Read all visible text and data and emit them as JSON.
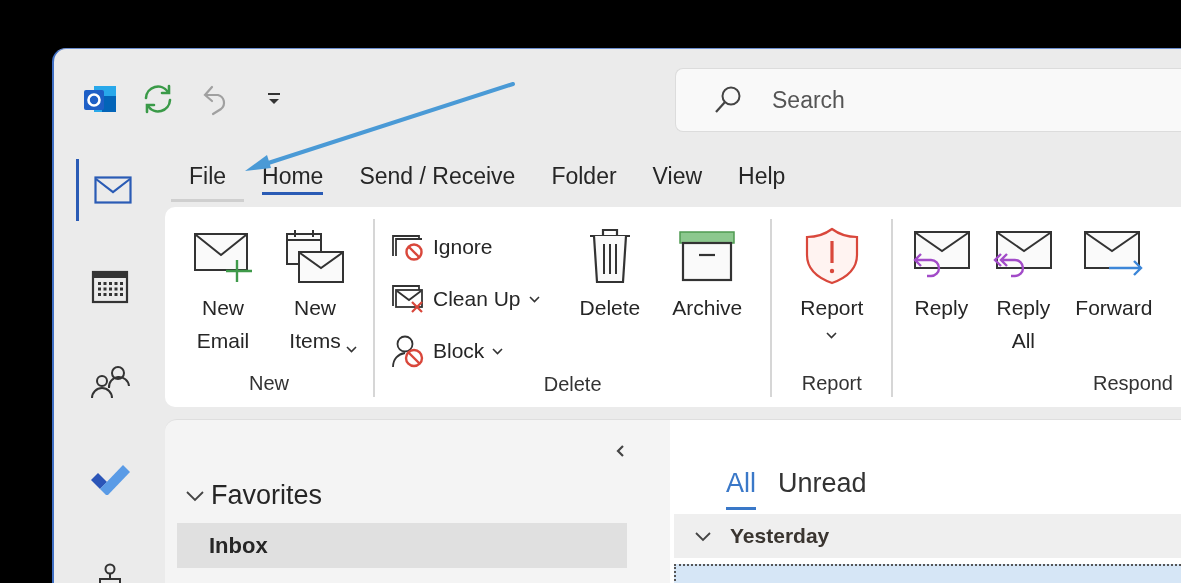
{
  "quick_access": [
    {
      "kind": "app",
      "disabled": false
    },
    {
      "kind": "sync",
      "disabled": false
    },
    {
      "kind": "undo",
      "disabled": true
    },
    {
      "kind": "customize",
      "disabled": false
    }
  ],
  "search": {
    "placeholder": "Search"
  },
  "nav_rail": [
    {
      "kind": "mail",
      "selected": true
    },
    {
      "kind": "calendar",
      "selected": false
    },
    {
      "kind": "people",
      "selected": false
    },
    {
      "kind": "todo",
      "selected": false
    },
    {
      "kind": "org",
      "selected": false
    }
  ],
  "ribbon_tabs": [
    {
      "label": "File",
      "kind": "file",
      "selected": false
    },
    {
      "label": "Home",
      "kind": "tab",
      "selected": true
    },
    {
      "label": "Send / Receive",
      "kind": "tab",
      "selected": false
    },
    {
      "label": "Folder",
      "kind": "tab",
      "selected": false
    },
    {
      "label": "View",
      "kind": "tab",
      "selected": false
    },
    {
      "label": "Help",
      "kind": "tab",
      "selected": false
    }
  ],
  "ribbon_groups": [
    {
      "label": "New",
      "buttons": [
        {
          "kind": "new-email",
          "label": "New Email",
          "dropdown": false
        },
        {
          "kind": "new-items",
          "label": "New Items",
          "dropdown": true
        }
      ]
    },
    {
      "label": "Delete",
      "buttons": [
        {
          "kind": "stack",
          "items": [
            {
              "kind": "ignore",
              "label": "Ignore",
              "dropdown": false
            },
            {
              "kind": "clean-up",
              "label": "Clean Up",
              "dropdown": true
            },
            {
              "kind": "block",
              "label": "Block",
              "dropdown": true
            }
          ]
        },
        {
          "kind": "delete",
          "label": "Delete",
          "dropdown": false
        },
        {
          "kind": "archive",
          "label": "Archive",
          "dropdown": false
        }
      ]
    },
    {
      "label": "Report",
      "buttons": [
        {
          "kind": "report",
          "label": "Report",
          "dropdown": true
        }
      ]
    },
    {
      "label": "Respond",
      "buttons": [
        {
          "kind": "reply",
          "label": "Reply",
          "dropdown": false
        },
        {
          "kind": "reply-all",
          "label": "Reply All",
          "dropdown": false
        },
        {
          "kind": "forward",
          "label": "Forward",
          "dropdown": false
        }
      ]
    }
  ],
  "folder_pane": {
    "sections": [
      {
        "label": "Favorites",
        "expanded": true,
        "folders": [
          {
            "label": "Inbox",
            "selected": true,
            "unread": true
          }
        ]
      }
    ]
  },
  "message_list": {
    "tabs": [
      {
        "label": "All",
        "selected": true
      },
      {
        "label": "Unread",
        "selected": false
      }
    ],
    "groups": [
      {
        "label": "Yesterday",
        "expanded": true,
        "messages": [
          {
            "selected": true
          }
        ]
      }
    ]
  }
}
